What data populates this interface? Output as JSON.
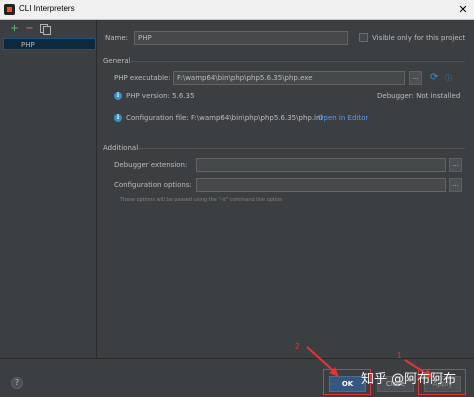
{
  "window": {
    "title": "CLI Interpreters",
    "close_glyph": "✕"
  },
  "toolbar": {
    "add": "+",
    "remove": "−"
  },
  "interpreters": [
    {
      "label": "PHP"
    }
  ],
  "form": {
    "name_label": "Name:",
    "name_value": "PHP",
    "visible_project_label": "Visible only for this project",
    "general_title": "General",
    "php_executable_label": "PHP executable:",
    "php_executable_value": "F:\\wamp64\\bin\\php\\php5.6.35\\php.exe",
    "php_version_text": "PHP version: 5.6.35",
    "debugger_text": "Debugger: Not installed",
    "config_file_text": "Configuration file: F:\\wamp64\\bin\\php\\php5.6.35\\php.ini",
    "open_in_editor": "Open in Editor",
    "additional_title": "Additional",
    "debugger_ext_label": "Debugger extension:",
    "config_options_label": "Configuration options:",
    "hint": "These options will be passed using the \"-d\" command line option",
    "dots": "..."
  },
  "buttons": {
    "help": "?",
    "ok": "OK",
    "cancel": "Close",
    "apply": "Apply"
  },
  "annotations": {
    "num1": "1",
    "num2": "2",
    "watermark": "知乎 @阿布阿布"
  },
  "colors": {
    "accent": "#365880",
    "link": "#589df6",
    "annotation": "#e43434"
  }
}
